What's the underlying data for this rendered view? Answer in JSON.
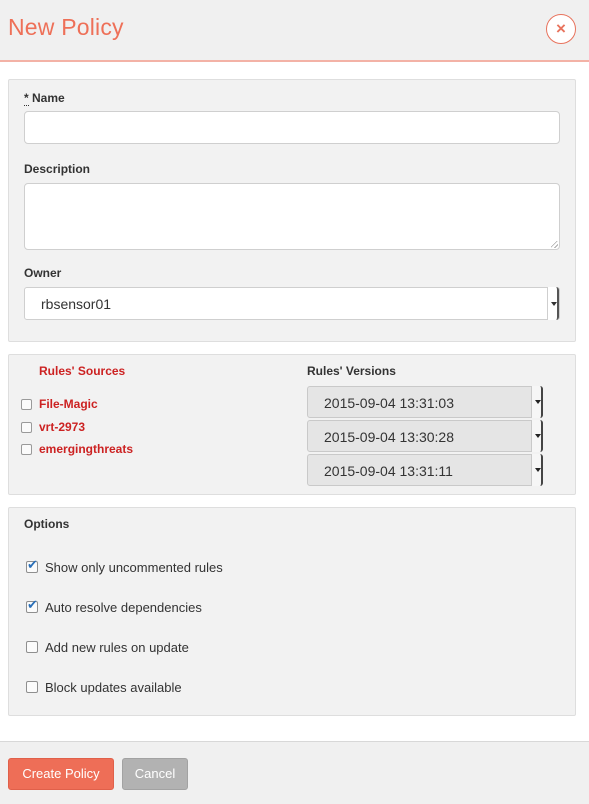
{
  "dialog": {
    "title": "New Policy",
    "close_icon": "×"
  },
  "general": {
    "name_required_marker": "*",
    "name_label": "Name",
    "name_value": "",
    "description_label": "Description",
    "description_value": "",
    "owner_label": "Owner",
    "owner_value": "rbsensor01"
  },
  "rules": {
    "sources_header": "Rules' Sources",
    "versions_header": "Rules' Versions",
    "sources": [
      {
        "name": "File-Magic",
        "checked": false,
        "version": "2015-09-04 13:31:03"
      },
      {
        "name": "vrt-2973",
        "checked": false,
        "version": "2015-09-04 13:30:28"
      },
      {
        "name": "emergingthreats",
        "checked": false,
        "version": "2015-09-04 13:31:11"
      }
    ]
  },
  "options": {
    "header": "Options",
    "items": [
      {
        "label": "Show only uncommented rules",
        "checked": true
      },
      {
        "label": "Auto resolve dependencies",
        "checked": true
      },
      {
        "label": "Add new rules on update",
        "checked": false
      },
      {
        "label": "Block updates available",
        "checked": false
      }
    ]
  },
  "footer": {
    "create_label": "Create Policy",
    "cancel_label": "Cancel"
  },
  "colors": {
    "accent": "#ee7058",
    "source_link": "#cc2222",
    "check": "#2a6fb8"
  }
}
